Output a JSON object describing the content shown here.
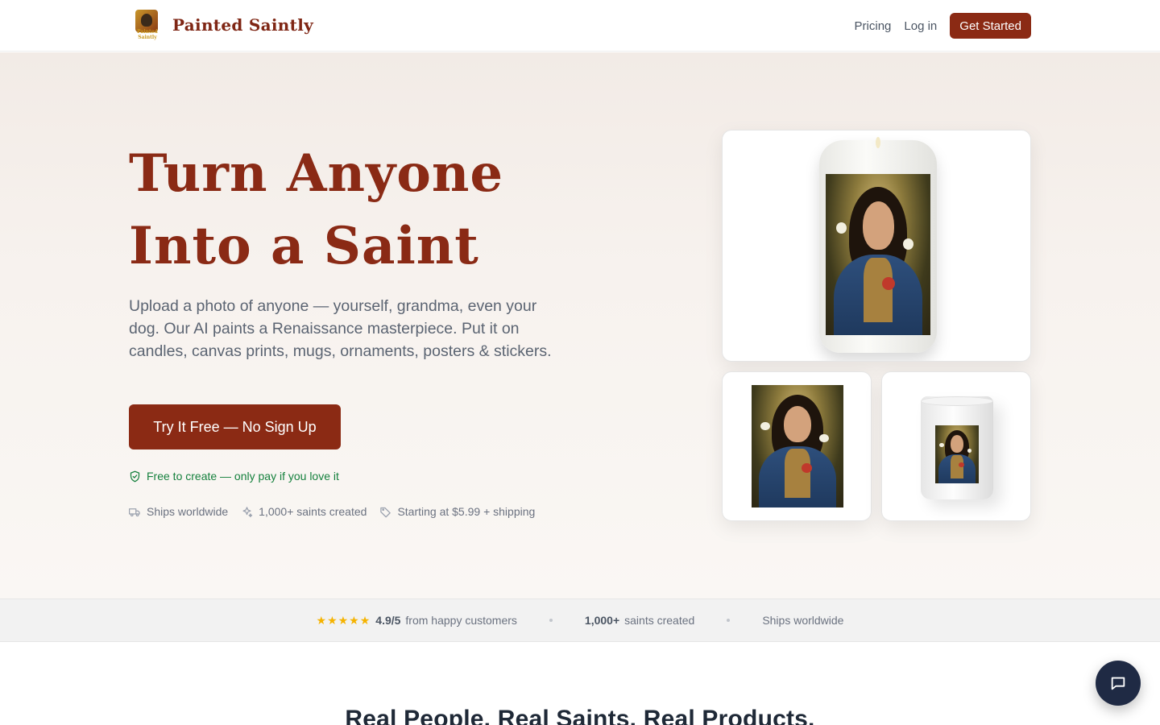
{
  "header": {
    "brand_name": "Painted Saintly",
    "logo_text": "Painted Saintly",
    "nav": {
      "pricing": "Pricing",
      "login": "Log in",
      "get_started": "Get Started"
    }
  },
  "hero": {
    "title": "Turn Anyone Into a Saint",
    "subtitle": "Upload a photo of anyone — yourself, grandma, even your dog. Our AI paints a Renaissance masterpiece. Put it on candles, canvas prints, mugs, ornaments, posters & stickers.",
    "cta_label": "Try It Free — No Sign Up",
    "free_note": "Free to create — only pay if you love it",
    "features": [
      {
        "icon": "truck-icon",
        "label": "Ships worldwide"
      },
      {
        "icon": "sparkles-icon",
        "label": "1,000+ saints created"
      },
      {
        "icon": "tag-icon",
        "label": "Starting at $5.99 + shipping"
      }
    ]
  },
  "products": {
    "main": "candle",
    "secondary": [
      "canvas-print",
      "mug"
    ]
  },
  "stats": {
    "stars": "★★★★★",
    "rating": "4.9/5",
    "rating_suffix": "from happy customers",
    "saints_count": "1,000+",
    "saints_suffix": "saints created",
    "shipping": "Ships worldwide"
  },
  "section": {
    "title": "Real People. Real Saints. Real Products."
  },
  "colors": {
    "brand": "#8b2a14",
    "success": "#15803d",
    "star": "#f5b300",
    "chat": "#1f2a44"
  }
}
